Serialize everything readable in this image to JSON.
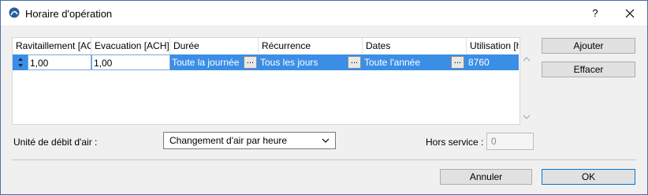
{
  "window": {
    "title": "Horaire d'opération",
    "help_glyph": "?",
    "close_glyph": "✕"
  },
  "table": {
    "columns": [
      "Ravitaillement [ACH]",
      "Evacuation [ACH]",
      "Durée",
      "Récurrence",
      "Dates",
      "Utilisation [h]"
    ],
    "rows": [
      {
        "ravitaillement": "1,00",
        "evacuation": "1,00",
        "duree": "Toute la journée",
        "recurrence": "Tous les jours",
        "dates": "Toute l'année",
        "utilisation": "8760"
      }
    ],
    "ellipsis": "..."
  },
  "buttons": {
    "add": "Ajouter",
    "clear": "Effacer",
    "cancel": "Annuler",
    "ok": "OK"
  },
  "airflow": {
    "label": "Unité de débit d'air :",
    "selected": "Changement d'air par heure"
  },
  "out_of_service": {
    "label": "Hors service :",
    "value": "0"
  },
  "colors": {
    "selection": "#3a8ee6",
    "accent_border": "#0078d7"
  }
}
